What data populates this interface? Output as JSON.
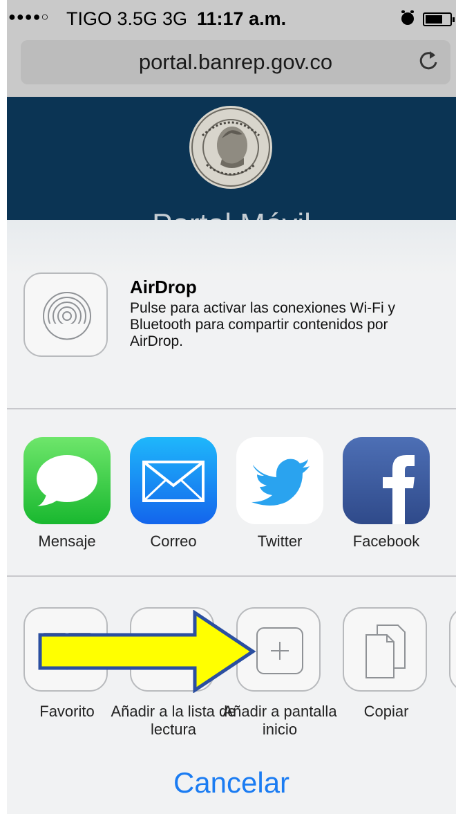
{
  "status_bar": {
    "signal_dots": "●●●●○",
    "carrier": "TIGO 3.5G",
    "network": "3G",
    "time": "11:17 a.m.",
    "alarm_icon": "alarm-icon",
    "battery_icon": "battery-icon"
  },
  "browser": {
    "url": "portal.banrep.gov.co",
    "reload_icon": "reload-icon"
  },
  "page": {
    "title": "Portal Móvil"
  },
  "share_sheet": {
    "airdrop": {
      "title": "AirDrop",
      "description": "Pulse para activar las conexiones Wi-Fi y Bluetooth para compartir contenidos por AirDrop."
    },
    "apps": [
      {
        "label": "Mensaje",
        "icon": "messages-icon",
        "color": "#35c64a"
      },
      {
        "label": "Correo",
        "icon": "mail-icon",
        "color": "#1e8cf5"
      },
      {
        "label": "Twitter",
        "icon": "twitter-icon",
        "color": "#ffffff"
      },
      {
        "label": "Facebook",
        "icon": "facebook-icon",
        "color": "#3b5998"
      }
    ],
    "actions": [
      {
        "label": "Favorito",
        "icon": "bookmark-icon"
      },
      {
        "label": "Añadir a la lista de lectura",
        "icon": "reading-list-icon"
      },
      {
        "label": "Añadir a pantalla inicio",
        "icon": "add-home-icon"
      },
      {
        "label": "Copiar",
        "icon": "copy-icon"
      }
    ],
    "cancel_label": "Cancelar"
  },
  "annotation": {
    "arrow_color": "#ffff00",
    "arrow_outline": "#2b4fa0"
  }
}
